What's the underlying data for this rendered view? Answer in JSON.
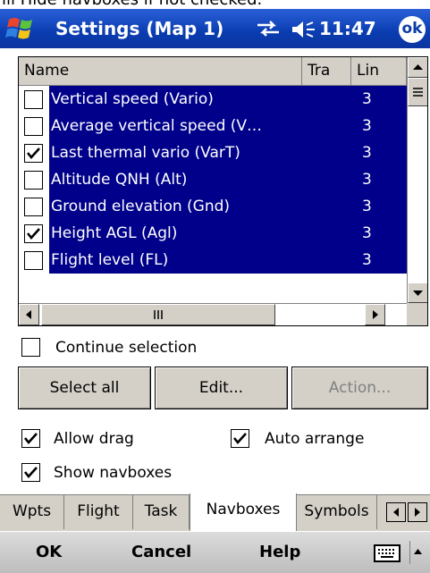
{
  "caption": {
    "text": "ill Hide navboxes if not checked."
  },
  "titlebar": {
    "title": "Settings (Map 1)",
    "time": "11:47",
    "ok_label": "ok",
    "icons": [
      "windows-start-icon",
      "connectivity-icon",
      "volume-icon"
    ],
    "color": "#0a3cb0"
  },
  "list": {
    "columns": {
      "name": "Name",
      "tra": "Tra",
      "lin": "Lin"
    },
    "selection_color": "#00008b",
    "rows": [
      {
        "name": "Vertical speed (Vario)",
        "lin": "3",
        "checked": false
      },
      {
        "name": "Average vertical speed (V…",
        "lin": "3",
        "checked": false
      },
      {
        "name": "Last thermal vario (VarT)",
        "lin": "3",
        "checked": true
      },
      {
        "name": "Altitude QNH (Alt)",
        "lin": "3",
        "checked": false
      },
      {
        "name": "Ground elevation (Gnd)",
        "lin": "3",
        "checked": false
      },
      {
        "name": "Height AGL (Agl)",
        "lin": "3",
        "checked": true
      },
      {
        "name": "Flight level (FL)",
        "lin": "3",
        "checked": false
      }
    ]
  },
  "options": {
    "continue_selection": {
      "label": "Continue selection",
      "checked": false
    },
    "allow_drag": {
      "label": "Allow drag",
      "checked": true
    },
    "auto_arrange": {
      "label": "Auto arrange",
      "checked": true
    },
    "show_navboxes": {
      "label": "Show navboxes",
      "checked": true
    }
  },
  "buttons": {
    "select_all": "Select all",
    "edit": "Edit...",
    "action": "Action..."
  },
  "tabs": [
    "Wpts",
    "Flight",
    "Task",
    "Navboxes",
    "Symbols"
  ],
  "active_tab": "Navboxes",
  "menubar": {
    "ok": "OK",
    "cancel": "Cancel",
    "help": "Help"
  }
}
